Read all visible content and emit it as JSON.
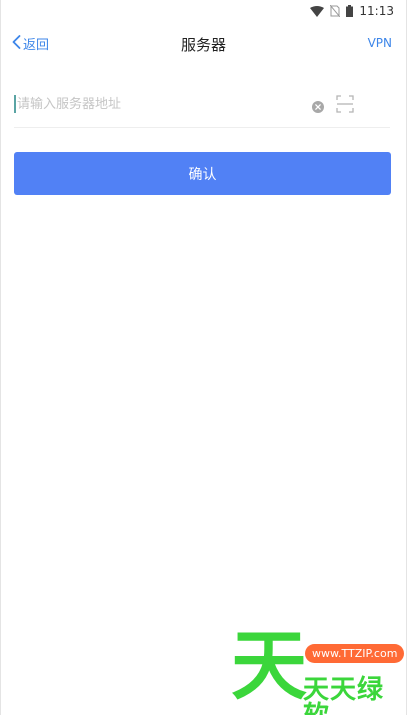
{
  "status_bar": {
    "time": "11:13",
    "icons": [
      "wifi-icon",
      "no-sim-icon",
      "battery-icon"
    ]
  },
  "nav": {
    "back_label": "返回",
    "title": "服务器",
    "vpn_label": "VPN"
  },
  "form": {
    "server_input": {
      "placeholder": "请输入服务器地址",
      "value": ""
    },
    "clear_icon": "clear-circle-icon",
    "scan_icon": "scan-icon",
    "confirm_label": "确认"
  },
  "watermark": {
    "big_char": "天",
    "url": "www.TTZIP.com",
    "brand": "天天绿软"
  },
  "colors": {
    "accent": "#3d86e9",
    "button": "#5181f5",
    "watermark_green": "#3bd63b",
    "watermark_orange": "#ff6a35"
  }
}
